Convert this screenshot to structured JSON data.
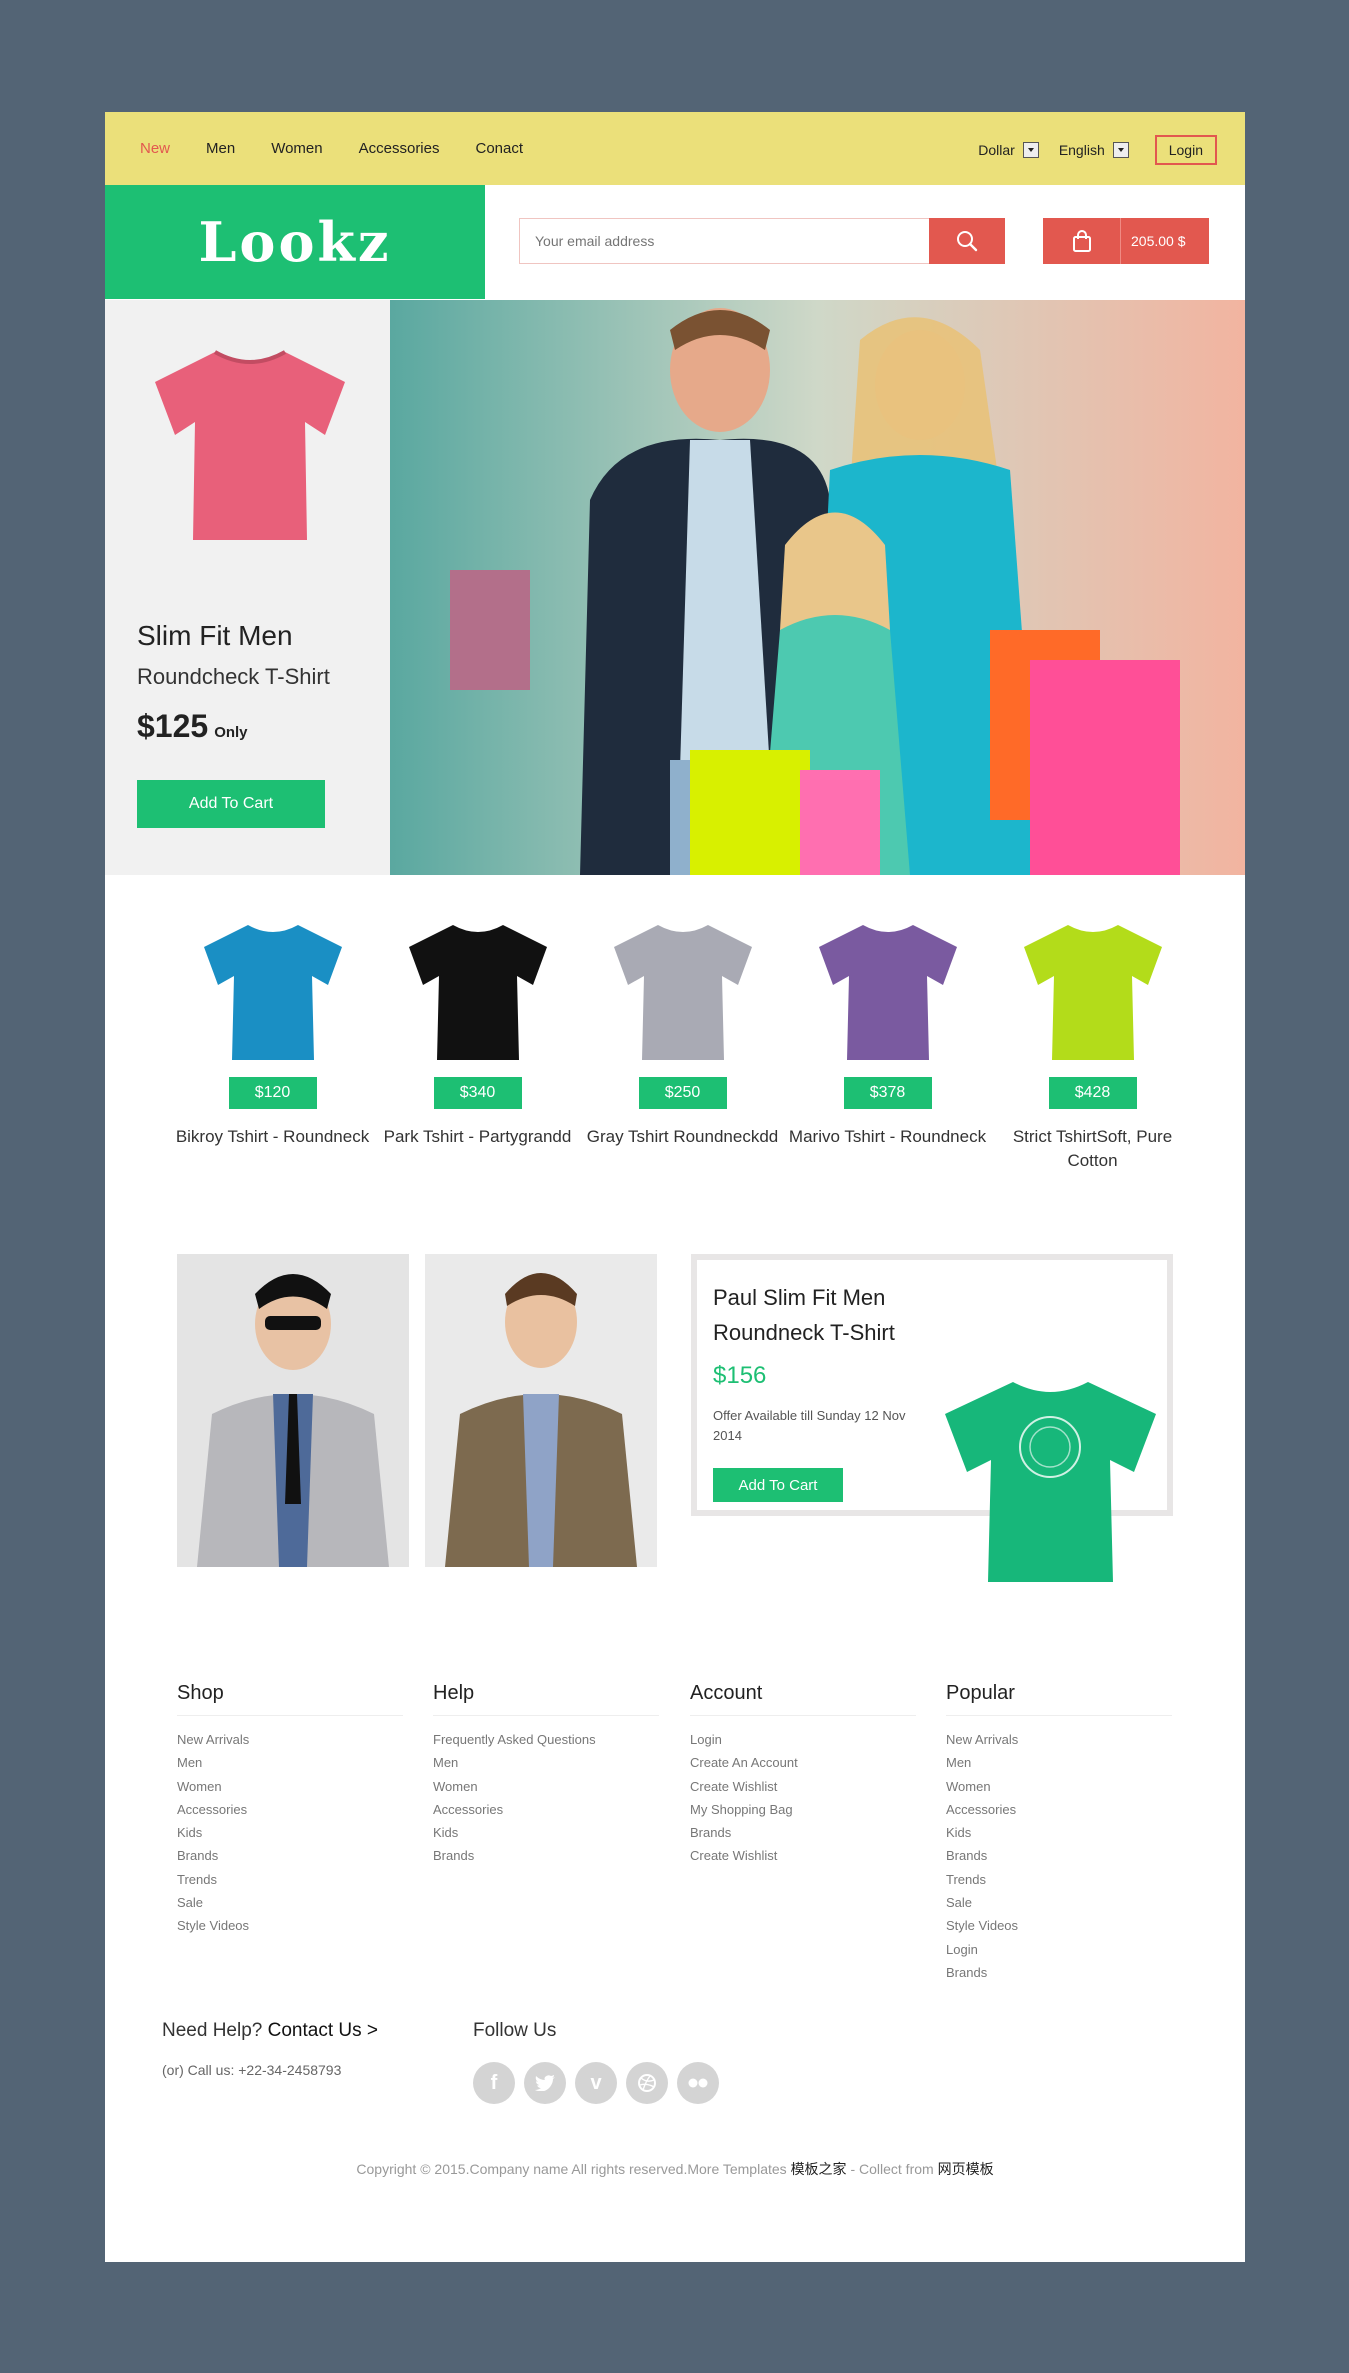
{
  "topnav": {
    "items": [
      {
        "label": "New",
        "active": true
      },
      {
        "label": "Men"
      },
      {
        "label": "Women"
      },
      {
        "label": "Accessories"
      },
      {
        "label": "Conact"
      }
    ],
    "currency": "Dollar",
    "language": "English",
    "login": "Login"
  },
  "header": {
    "logo": "Lookz",
    "search_placeholder": "Your email address",
    "cart_total": "205.00 $"
  },
  "hero": {
    "title": "Slim Fit Men",
    "subtitle": "Roundcheck T-Shirt",
    "price": "$125",
    "price_suffix": "Only",
    "button": "Add To Cart"
  },
  "products": [
    {
      "price": "$120",
      "name": "Bikroy Tshirt - Roundneck",
      "color": "#1a8fc4"
    },
    {
      "price": "$340",
      "name": "Park Tshirt - Partygrandd",
      "color": "#111111"
    },
    {
      "price": "$250",
      "name": "Gray Tshirt Roundneckdd",
      "color": "#a9aab4"
    },
    {
      "price": "$378",
      "name": "Marivo Tshirt - Roundneck",
      "color": "#7a5aa0"
    },
    {
      "price": "$428",
      "name": "Strict TshirtSoft, Pure Cotton",
      "color": "#b3dc1a"
    }
  ],
  "feature": {
    "title": "Paul Slim Fit Men Roundneck T-Shirt",
    "price": "$156",
    "offer": "Offer Available till Sunday 12 Nov 2014",
    "button": "Add To Cart"
  },
  "footer": {
    "columns": [
      {
        "title": "Shop",
        "links": [
          "New Arrivals",
          "Men",
          "Women",
          "Accessories",
          "Kids",
          "Brands",
          "Trends",
          "Sale",
          "Style Videos"
        ]
      },
      {
        "title": "Help",
        "links": [
          "Frequently Asked Questions",
          "Men",
          "Women",
          "Accessories",
          "Kids",
          "Brands"
        ]
      },
      {
        "title": "Account",
        "links": [
          "Login",
          "Create An Account",
          "Create Wishlist",
          "My Shopping Bag",
          "Brands",
          "Create Wishlist"
        ]
      },
      {
        "title": "Popular",
        "links": [
          "New Arrivals",
          "Men",
          "Women",
          "Accessories",
          "Kids",
          "Brands",
          "Trends",
          "Sale",
          "Style Videos",
          "Login",
          "Brands"
        ]
      }
    ],
    "help_prefix": "Need Help?",
    "help_link": "Contact Us >",
    "call": "(or) Call us: +22-34-2458793",
    "follow": "Follow Us",
    "socials": [
      "facebook-icon",
      "twitter-icon",
      "vimeo-icon",
      "dribbble-icon",
      "flickr-icon"
    ],
    "copyright": "Copyright © 2015.Company name All rights reserved.More Templates",
    "link1": "模板之家",
    "sep": " - Collect from ",
    "link2": "网页模板"
  },
  "colors": {
    "green": "#1dbf73",
    "red": "#e2584f",
    "yellow": "#ebe07a",
    "background": "#536475"
  }
}
